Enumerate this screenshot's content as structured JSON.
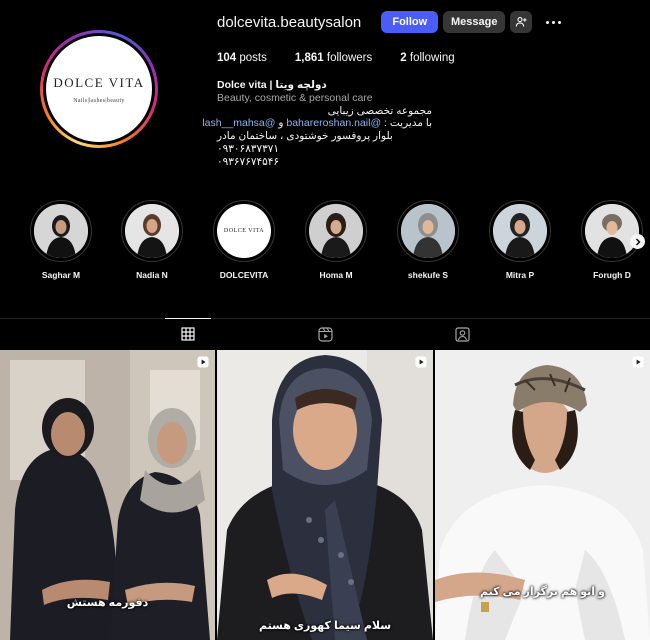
{
  "profile": {
    "username": "dolcevita.beautysalon",
    "avatar": {
      "brand": "DOLCE VITA",
      "tagline": "Nails|lashes|beauty"
    },
    "buttons": {
      "follow": "Follow",
      "message": "Message",
      "add_icon": "add-person-icon",
      "more_icon": "more-options-icon"
    },
    "stats": {
      "posts_count": "104",
      "posts_label": "posts",
      "followers_count": "1,861",
      "followers_label": "followers",
      "following_count": "2",
      "following_label": "following"
    },
    "bio": {
      "name": "Dolce vita | دولچه ویتا",
      "category": "Beauty, cosmetic & personal care",
      "line1": "مجموعه تخصصی زیبایی",
      "line2_prefix": "با مدیریت :",
      "line2_mention1": "@bahareroshan.nail",
      "line2_and": "و",
      "line2_mention2": "@lash__mahsa",
      "line3": "بلوار پروفسور خوشتودی ، ساختمان مادر",
      "phone1": "۰۹۳۰۶۸۳۷۳۷۱",
      "phone2": "۰۹۳۶۷۶۷۴۵۴۶"
    },
    "colors": {
      "accent": "#4a5df9",
      "background": "#000000",
      "secondary_button": "#363636"
    }
  },
  "highlights": [
    {
      "label": "Saghar M"
    },
    {
      "label": "Nadia N"
    },
    {
      "label": "DOLCEVITA",
      "logo_text": "DOLCE VITA"
    },
    {
      "label": "Homa M"
    },
    {
      "label": "shekufe S"
    },
    {
      "label": "Mitra P"
    },
    {
      "label": "Forugh D"
    }
  ],
  "tabs": [
    {
      "name": "posts",
      "icon": "grid-icon",
      "active": true
    },
    {
      "name": "reels",
      "icon": "reels-icon",
      "active": false
    },
    {
      "name": "tagged",
      "icon": "tagged-icon",
      "active": false
    }
  ],
  "posts": [
    {
      "type": "reel",
      "caption": "دفورمه هستش"
    },
    {
      "type": "reel",
      "caption": "سلام سیما کهوری هستم"
    },
    {
      "type": "reel",
      "caption": "و اتو هم برگزار می کنم"
    }
  ]
}
